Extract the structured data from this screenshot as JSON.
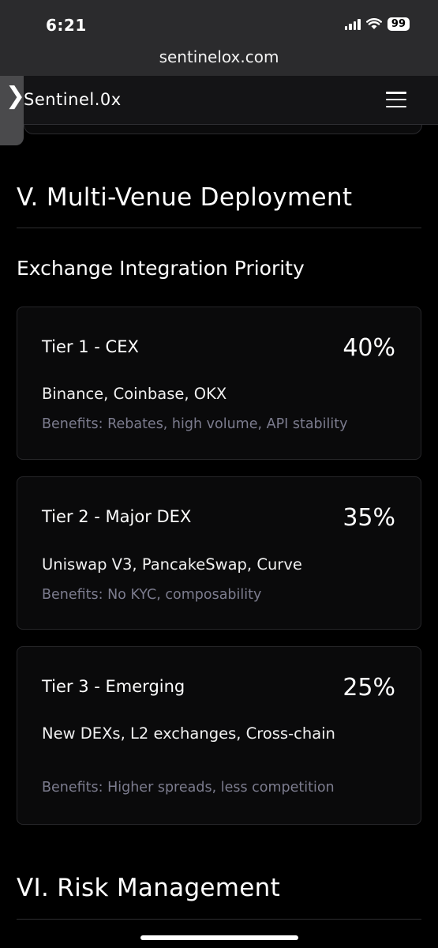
{
  "status_bar": {
    "time": "6:21",
    "battery": "99"
  },
  "browser": {
    "url": "sentinelox.com"
  },
  "navbar": {
    "brand": "Sentinel.0x"
  },
  "sections": {
    "deployment_title": "V. Multi-Venue Deployment",
    "exchange_heading": "Exchange Integration Priority",
    "risk_title": "VI. Risk Management"
  },
  "tiers": [
    {
      "title": "Tier 1 - CEX",
      "percent": "40%",
      "venues": "Binance, Coinbase, OKX",
      "benefits": "Benefits: Rebates, high volume, API stability"
    },
    {
      "title": "Tier 2 - Major DEX",
      "percent": "35%",
      "venues": "Uniswap V3, PancakeSwap, Curve",
      "benefits": "Benefits: No KYC, composability"
    },
    {
      "title": "Tier 3 - Emerging",
      "percent": "25%",
      "venues": "New DEXs, L2 exchanges, Cross-chain",
      "benefits": "Benefits: Higher spreads, less competition"
    }
  ]
}
